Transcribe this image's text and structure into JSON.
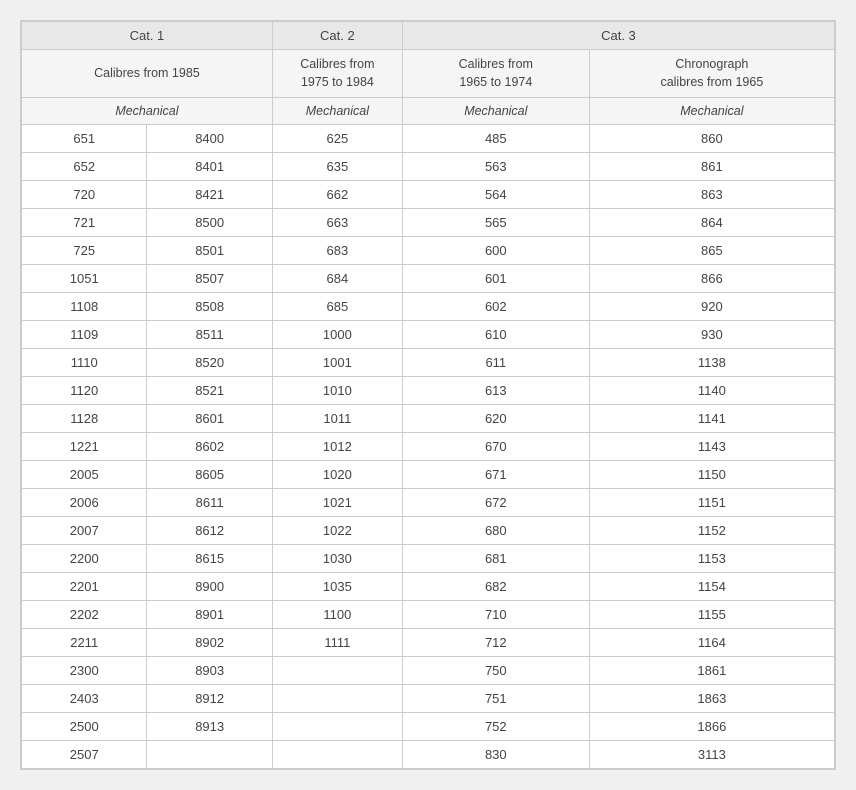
{
  "table": {
    "categories": [
      {
        "label": "Cat. 1",
        "colspan": 2
      },
      {
        "label": "Cat. 2",
        "colspan": 1
      },
      {
        "label": "Cat. 3",
        "colspan": 2
      }
    ],
    "subcategories": [
      {
        "label": "Calibres from 1985",
        "colspan": 2
      },
      {
        "label": "Calibres from\n1975 to 1984",
        "colspan": 1
      },
      {
        "label": "Calibres from\n1965 to 1974",
        "colspan": 1
      },
      {
        "label": "Chronograph\ncalibres from 1965",
        "colspan": 1
      }
    ],
    "mech_headers": [
      "Mechanical",
      "Mechanical",
      "Mechanical",
      "Mechanical"
    ],
    "rows": [
      [
        "651",
        "8400",
        "625",
        "485",
        "860"
      ],
      [
        "652",
        "8401",
        "635",
        "563",
        "861"
      ],
      [
        "720",
        "8421",
        "662",
        "564",
        "863"
      ],
      [
        "721",
        "8500",
        "663",
        "565",
        "864"
      ],
      [
        "725",
        "8501",
        "683",
        "600",
        "865"
      ],
      [
        "1051",
        "8507",
        "684",
        "601",
        "866"
      ],
      [
        "1108",
        "8508",
        "685",
        "602",
        "920"
      ],
      [
        "1109",
        "8511",
        "1000",
        "610",
        "930"
      ],
      [
        "1110",
        "8520",
        "1001",
        "611",
        "1138"
      ],
      [
        "1120",
        "8521",
        "1010",
        "613",
        "1140"
      ],
      [
        "1128",
        "8601",
        "1011",
        "620",
        "1141"
      ],
      [
        "1221",
        "8602",
        "1012",
        "670",
        "1143"
      ],
      [
        "2005",
        "8605",
        "1020",
        "671",
        "1150"
      ],
      [
        "2006",
        "8611",
        "1021",
        "672",
        "1151"
      ],
      [
        "2007",
        "8612",
        "1022",
        "680",
        "1152"
      ],
      [
        "2200",
        "8615",
        "1030",
        "681",
        "1153"
      ],
      [
        "2201",
        "8900",
        "1035",
        "682",
        "1154"
      ],
      [
        "2202",
        "8901",
        "1100",
        "710",
        "1155"
      ],
      [
        "2211",
        "8902",
        "1111",
        "712",
        "1164"
      ],
      [
        "2300",
        "8903",
        "",
        "750",
        "1861"
      ],
      [
        "2403",
        "8912",
        "",
        "751",
        "1863"
      ],
      [
        "2500",
        "8913",
        "",
        "752",
        "1866"
      ],
      [
        "2507",
        "",
        "",
        "830",
        "3113"
      ]
    ]
  }
}
